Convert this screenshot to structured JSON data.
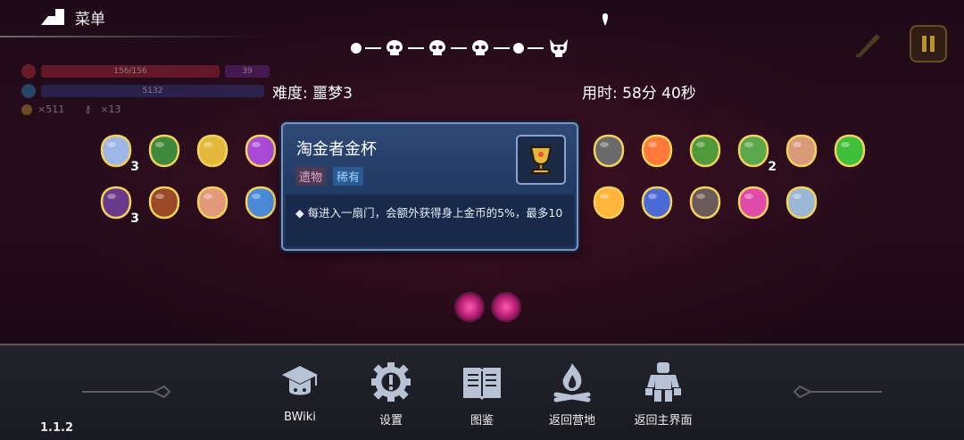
{
  "menu": {
    "label": "菜单"
  },
  "hud": {
    "hp": "156/156",
    "shield": "39",
    "mana": "5132",
    "gold": "×511",
    "keys": "×13"
  },
  "run": {
    "difficulty": "难度: 噩梦3",
    "elapsed": "用时: 58分 40秒",
    "path": [
      "dot",
      "skull",
      "skull",
      "skull",
      "dot",
      "boss-skull"
    ]
  },
  "items": [
    {
      "icon": "ghost-icon",
      "color": "#9fb7e8",
      "count": "3"
    },
    {
      "icon": "green-belt-icon",
      "color": "#3f8a3a",
      "count": ""
    },
    {
      "icon": "golden-goblet-icon",
      "color": "#e2b93b",
      "count": ""
    },
    {
      "icon": "rainbow-cape-icon",
      "color": "#a84ad6",
      "count": ""
    },
    {
      "icon": "stone-idol-icon",
      "color": "#6a6a6a",
      "count": ""
    },
    {
      "icon": "heart-icon",
      "color": "#ff7a3a",
      "count": ""
    },
    {
      "icon": "green-boot-icon",
      "color": "#4f9a3a",
      "count": ""
    },
    {
      "icon": "leaf-sprig-icon",
      "color": "#5aa84a",
      "count": "2"
    },
    {
      "icon": "arrow-icon",
      "color": "#d99a7a",
      "count": ""
    },
    {
      "icon": "green-flame-icon",
      "color": "#3fbf3a",
      "count": ""
    },
    {
      "icon": "purple-robe-icon",
      "color": "#6a3a8a",
      "count": "3"
    },
    {
      "icon": "wooden-crate-icon",
      "color": "#9a4a2a",
      "count": ""
    },
    {
      "icon": "flesh-creature-icon",
      "color": "#e39a7a",
      "count": ""
    },
    {
      "icon": "blue-ring-icon",
      "color": "#4a8ad6",
      "count": ""
    },
    {
      "icon": "candy-cone-icon",
      "color": "#ffb43a",
      "count": ""
    },
    {
      "icon": "blue-jellyfish-icon",
      "color": "#4a6ad6",
      "count": ""
    },
    {
      "icon": "brown-cloak-icon",
      "color": "#6a5a5a",
      "count": ""
    },
    {
      "icon": "pink-demon-mask-icon",
      "color": "#e04aa8",
      "count": ""
    },
    {
      "icon": "magnifier-icon",
      "color": "#9ab8d6",
      "count": ""
    }
  ],
  "tooltip": {
    "name": "淘金者金杯",
    "type": "遗物",
    "rarity": "稀有",
    "description": "◆  每进入一扇门，会额外获得身上金币的5%，最多10"
  },
  "bottom_nav": [
    {
      "icon": "graduation-cap-icon",
      "label": "BWiki"
    },
    {
      "icon": "gear-icon",
      "label": "设置"
    },
    {
      "icon": "book-icon",
      "label": "图鉴"
    },
    {
      "icon": "campfire-icon",
      "label": "返回营地"
    },
    {
      "icon": "stone-golem-icon",
      "label": "返回主界面"
    }
  ],
  "version": "1.1.2"
}
